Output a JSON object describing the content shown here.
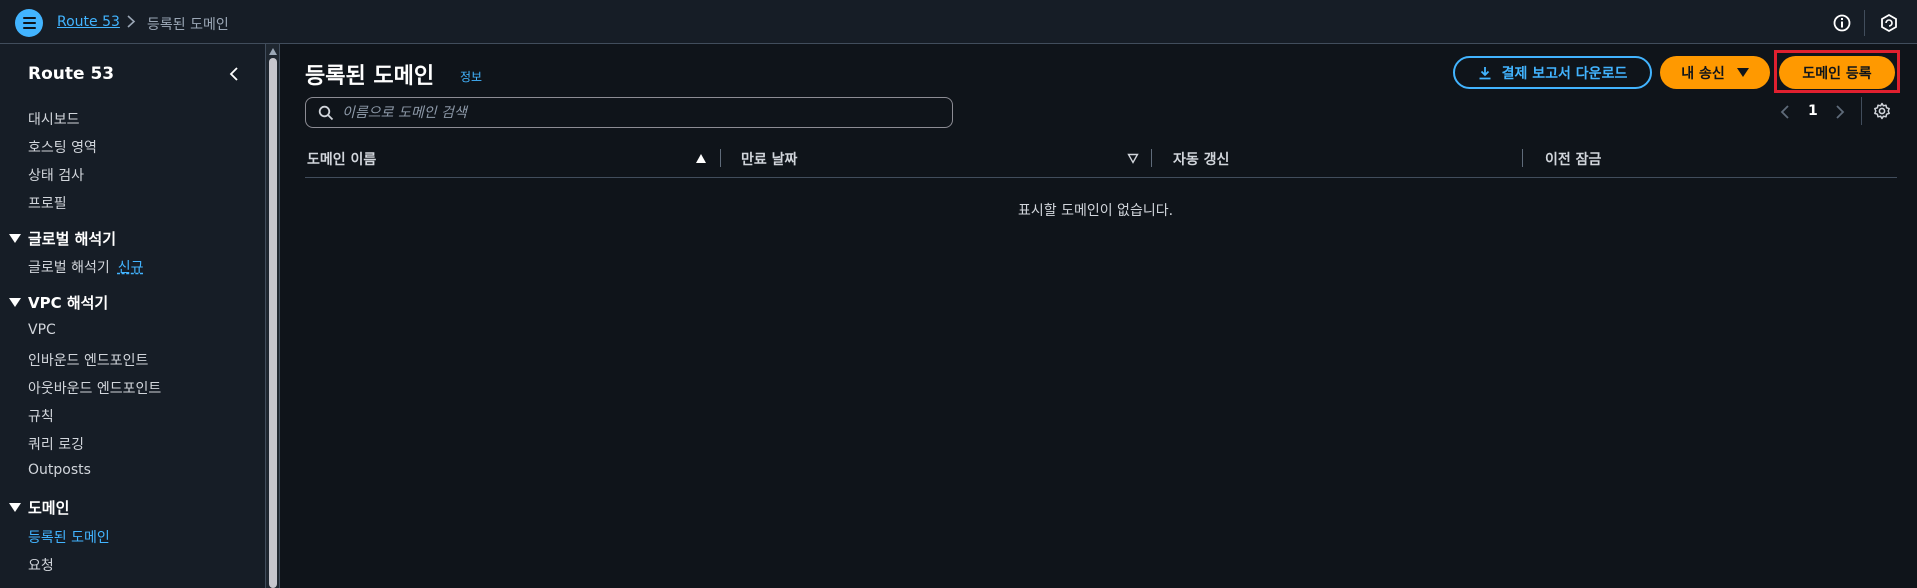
{
  "topbar": {
    "breadcrumb_link": "Route 53",
    "breadcrumb_current": "등록된 도메인"
  },
  "sidebar": {
    "title": "Route 53",
    "items": [
      "대시보드",
      "호스팅 영역",
      "상태 검사",
      "프로필"
    ],
    "global_resolver": {
      "title": "글로벌 해석기",
      "item": "글로벌 해석기",
      "badge": "신규"
    },
    "vpc_resolver": {
      "title": "VPC 해석기",
      "items": [
        "VPC",
        "인바운드 엔드포인트",
        "아웃바운드 엔드포인트",
        "규칙",
        "쿼리 로깅",
        "Outposts"
      ]
    },
    "domains": {
      "title": "도메인",
      "items": [
        "등록된 도메인",
        "요청"
      ]
    }
  },
  "main": {
    "title": "등록된 도메인",
    "info_link": "정보",
    "download_button": "결제 보고서 다운로드",
    "my_send_button": "내 송신",
    "register_button": "도메인 등록",
    "search_placeholder": "이름으로 도메인 검색",
    "page_number": "1",
    "table": {
      "columns": [
        "도메인 이름",
        "만료 날짜",
        "자동 갱신",
        "이전 잠금"
      ],
      "empty_message": "표시할 도메인이 없습니다."
    }
  },
  "colors": {
    "accent_blue": "#42b4ff",
    "primary_orange": "#ff9900",
    "highlight_red": "#e0202f",
    "background": "#0f141a"
  }
}
